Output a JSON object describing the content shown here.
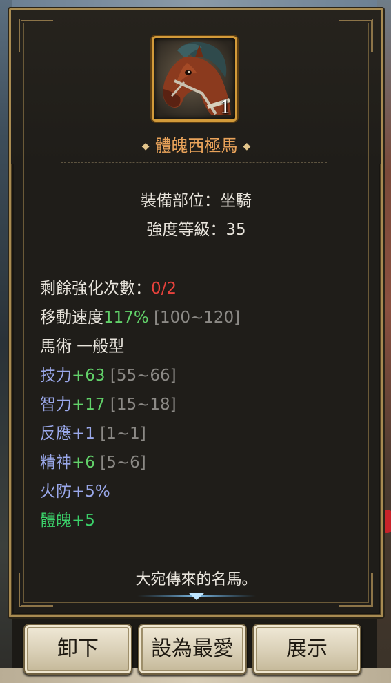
{
  "item": {
    "name": "體魄西極馬",
    "quantity": "1",
    "icon": "horse-icon",
    "equip_slot": "裝備部位：坐騎",
    "strength_level": "強度等級：35"
  },
  "stats": {
    "enhance_label": "剩餘強化次數：",
    "enhance_value": "0/2",
    "speed_label": "移動速度",
    "speed_value": "117%",
    "speed_range": " [100~120]",
    "horsemanship": "馬術 一般型",
    "skill_label": "技力",
    "skill_value": "+63",
    "skill_range": " [55~66]",
    "intel_label": "智力",
    "intel_value": "+17",
    "intel_range": " [15~18]",
    "react_label": "反應",
    "react_value": "+1",
    "react_range": " [1~1]",
    "spirit_label": "精神",
    "spirit_value": "+6",
    "spirit_range": " [5~6]",
    "fire_res": "火防+5%",
    "physique": "體魄+5"
  },
  "description": "大宛傳來的名馬。",
  "buttons": {
    "unequip": "卸下",
    "favorite": "設為最愛",
    "show": "展示"
  },
  "colors": {
    "frame_gold": "#a88b52",
    "name_orange": "#e9a35a",
    "value_green": "#62d26a",
    "warn_red": "#e8423c",
    "stat_blue": "#9aa8ea"
  }
}
